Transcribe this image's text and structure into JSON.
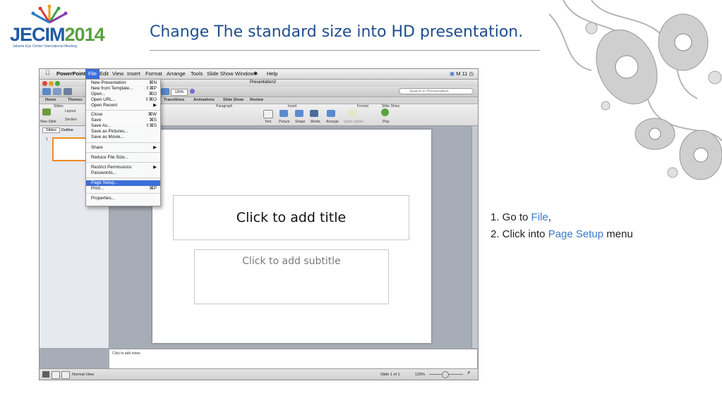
{
  "logo": {
    "text_a": "JECIM",
    "text_b": "2014",
    "subtitle": "Jakarta Eye Center International Meeting"
  },
  "slide_title": "Change The standard size into HD presentation.",
  "steps": {
    "step1_prefix": "1. Go to ",
    "step1_link": "File",
    "step1_suffix": ",",
    "step2_prefix": "2. Click into ",
    "step2_link": "Page Setup",
    "step2_suffix": " menu"
  },
  "screenshot": {
    "menubar": [
      "PowerPoint",
      "File",
      "Edit",
      "View",
      "Insert",
      "Format",
      "Arrange",
      "Tools",
      "Slide Show",
      "Window",
      "Help"
    ],
    "menubar_right": "M 11",
    "window_title": "Presentation2",
    "zoom": "125%",
    "search_placeholder": "Search in Presentation",
    "ribbon_tabs": [
      "Home",
      "Themes",
      "Transitions",
      "Animations",
      "Slide Show",
      "Review"
    ],
    "ribbon_groups": [
      "Slides",
      "Paragraph",
      "Insert",
      "Format",
      "Slide Show"
    ],
    "ribbon_buttons": [
      "New Slide",
      "Layout",
      "Section",
      "Text",
      "Picture",
      "Shape",
      "Media",
      "Arrange",
      "Quick Styles",
      "Play"
    ],
    "pane_tabs": [
      "Slides",
      "Outline"
    ],
    "thumb_number": "1",
    "placeholder_title": "Click to add title",
    "placeholder_subtitle": "Click to add subtitle",
    "notes_placeholder": "Click to add notes",
    "status_view": "Normal View",
    "status_slide": "Slide 1 of 1",
    "status_zoom": "125%",
    "file_menu": [
      {
        "label": "New Presentation",
        "shortcut": "⌘N"
      },
      {
        "label": "New from Template...",
        "shortcut": "⇧⌘P"
      },
      {
        "label": "Open...",
        "shortcut": "⌘O"
      },
      {
        "label": "Open URL...",
        "shortcut": "⇧⌘O"
      },
      {
        "label": "Open Recent",
        "shortcut": "▶"
      },
      {
        "label": "Close",
        "shortcut": "⌘W"
      },
      {
        "label": "Save",
        "shortcut": "⌘S"
      },
      {
        "label": "Save As...",
        "shortcut": "⇧⌘S"
      },
      {
        "label": "Save as Pictures...",
        "shortcut": ""
      },
      {
        "label": "Save as Movie...",
        "shortcut": ""
      },
      {
        "label": "Share",
        "shortcut": "▶"
      },
      {
        "label": "Reduce File Size...",
        "shortcut": ""
      },
      {
        "label": "Restrict Permissions",
        "shortcut": "▶"
      },
      {
        "label": "Passwords...",
        "shortcut": ""
      },
      {
        "label": "Page Setup...",
        "shortcut": ""
      },
      {
        "label": "Print...",
        "shortcut": "⌘P"
      },
      {
        "label": "Properties...",
        "shortcut": ""
      }
    ],
    "selected_menu_item": "Page Setup..."
  },
  "colors": {
    "title": "#1f4e8c",
    "highlight": "#3a79c7",
    "menu_selection": "#3b6fd8",
    "thumb_border": "#f08a22"
  }
}
